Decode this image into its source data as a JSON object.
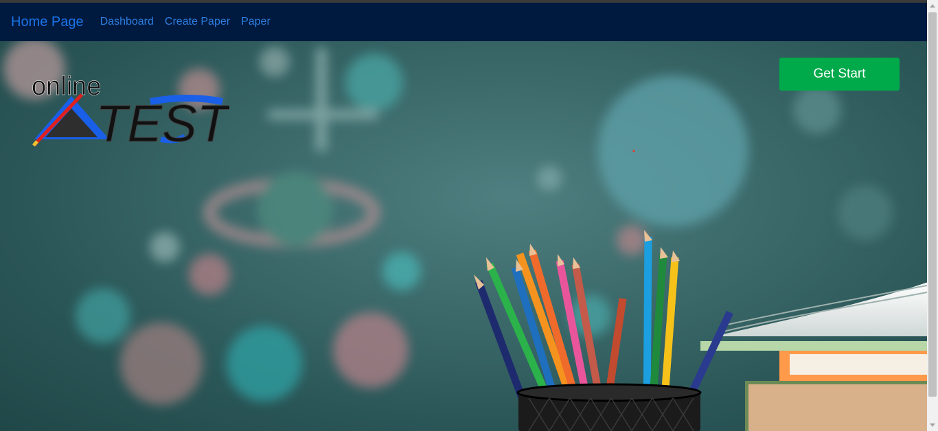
{
  "navbar": {
    "brand": "Home Page",
    "links": [
      "Dashboard",
      "Create Paper",
      "Paper"
    ]
  },
  "hero": {
    "logo_text_small": "online",
    "logo_text_big": "TEST",
    "cta_label": "Get Start"
  },
  "colors": {
    "navbar_bg": "#001a3f",
    "link": "#2e7de0",
    "cta_bg": "#00a94a",
    "hero_bg": "#3c6a6b"
  },
  "icons": {
    "logo": "pencil-triangle-logo-icon"
  }
}
